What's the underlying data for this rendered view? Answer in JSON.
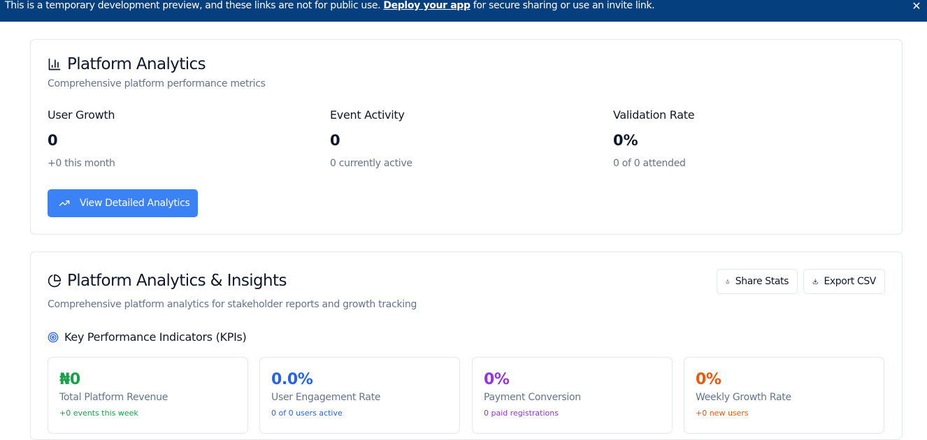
{
  "banner": {
    "text_before": "This is a temporary development preview, and these links are not for public use.",
    "link_label": "Deploy your app",
    "text_after": "for secure sharing or use an invite link.",
    "close_icon": "close-icon"
  },
  "platform_analytics": {
    "title": "Platform Analytics",
    "subtitle": "Comprehensive platform performance metrics",
    "icon": "bar-chart-icon",
    "metrics": [
      {
        "label": "User Growth",
        "value": "0",
        "note": "+0 this month"
      },
      {
        "label": "Event Activity",
        "value": "0",
        "note": "0 currently active"
      },
      {
        "label": "Validation Rate",
        "value": "0%",
        "note": "0 of 0 attended"
      }
    ],
    "button_label": "View Detailed Analytics",
    "button_icon": "trending-up-icon"
  },
  "insights": {
    "title": "Platform Analytics & Insights",
    "subtitle": "Comprehensive platform analytics for stakeholder reports and growth tracking",
    "icon": "pie-chart-icon",
    "share_label": "Share Stats",
    "export_label": "Export CSV",
    "kpi_heading": "Key Performance Indicators (KPIs)",
    "kpi_icon": "target-icon",
    "kpis": [
      {
        "value": "₦0",
        "label": "Total Platform Revenue",
        "note": "+0 events this week",
        "color": "#16a34a"
      },
      {
        "value": "0.0%",
        "label": "User Engagement Rate",
        "note": "0 of 0 users active",
        "color": "#2563eb"
      },
      {
        "value": "0%",
        "label": "Payment Conversion",
        "note": "0 paid registrations",
        "color": "#9333ea"
      },
      {
        "value": "0%",
        "label": "Weekly Growth Rate",
        "note": "+0 new users",
        "color": "#ea580c"
      }
    ]
  }
}
